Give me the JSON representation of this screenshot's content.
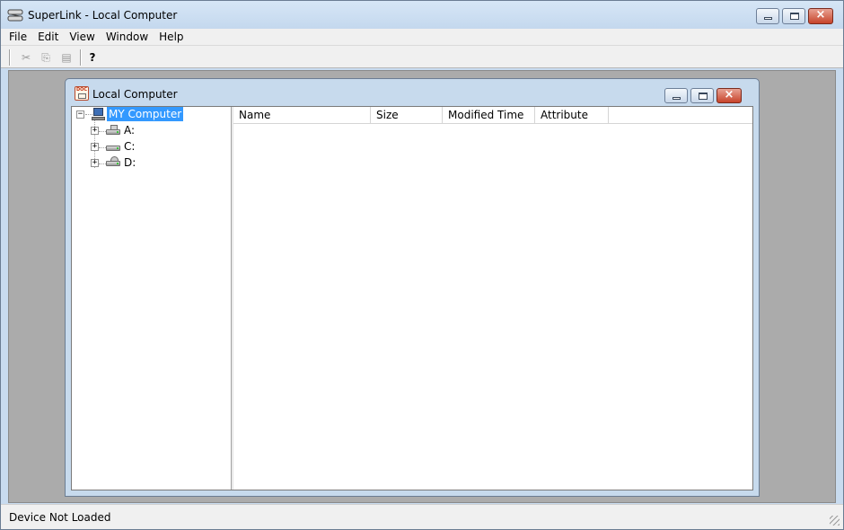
{
  "app": {
    "title": "SuperLink - Local Computer",
    "accent_color": "#3399ff",
    "close_color": "#c7432a"
  },
  "menu": {
    "items": [
      "File",
      "Edit",
      "View",
      "Window",
      "Help"
    ]
  },
  "toolbar": {
    "buttons": [
      {
        "icon": "cut-icon",
        "glyph": "✂",
        "enabled": false
      },
      {
        "icon": "copy-icon",
        "glyph": "⎘",
        "enabled": false
      },
      {
        "icon": "paste-icon",
        "glyph": "▤",
        "enabled": false
      },
      {
        "icon": "help-icon",
        "glyph": "?",
        "enabled": true
      }
    ]
  },
  "child_window": {
    "title": "Local Computer",
    "icon_text": "DOC"
  },
  "tree": {
    "root": {
      "label": "MY Computer",
      "expander": "−",
      "selected": true
    },
    "drives": [
      {
        "label": "A:",
        "icon": "floppy-drive-icon",
        "expander": "+"
      },
      {
        "label": "C:",
        "icon": "hard-drive-icon",
        "expander": "+"
      },
      {
        "label": "D:",
        "icon": "cd-drive-icon",
        "expander": "+"
      }
    ]
  },
  "list": {
    "columns": [
      "Name",
      "Size",
      "Modified Time",
      "Attribute"
    ],
    "rows": []
  },
  "status": {
    "text": "Device Not Loaded"
  }
}
